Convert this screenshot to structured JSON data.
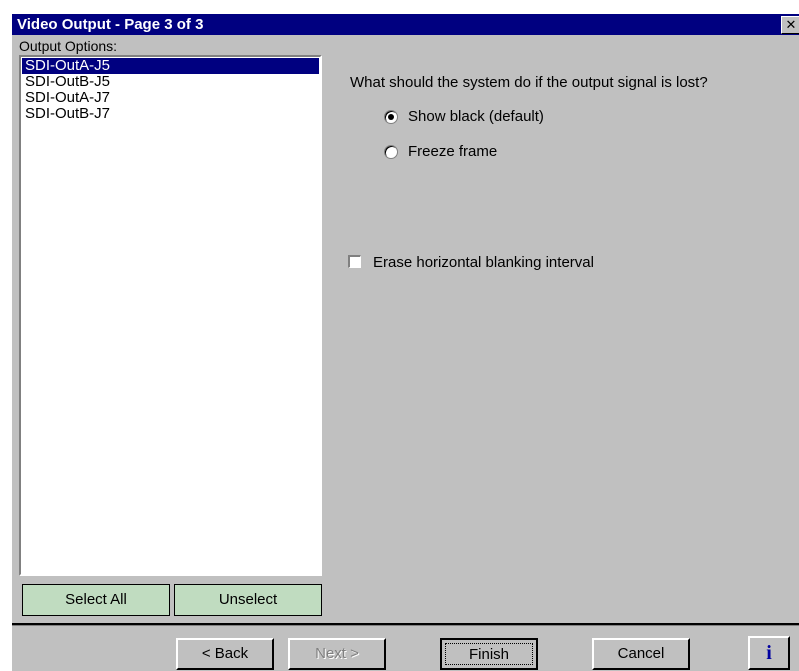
{
  "window": {
    "title": "Video Output - Page 3 of 3",
    "close_glyph": "✕"
  },
  "options": {
    "label": "Output Options:",
    "items": [
      "SDI-OutA-J5",
      "SDI-OutB-J5",
      "SDI-OutA-J7",
      "SDI-OutB-J7"
    ],
    "selected_index": 0,
    "select_all_label": "Select All",
    "unselect_label": "Unselect"
  },
  "signal_lost": {
    "question": "What should the system do if the output signal is lost?",
    "options": [
      {
        "label": "Show black (default)",
        "checked": true
      },
      {
        "label": "Freeze frame",
        "checked": false
      }
    ]
  },
  "blanking": {
    "label": "Erase horizontal blanking interval",
    "checked": false
  },
  "buttons": {
    "back": "< Back",
    "next": "Next >",
    "finish": "Finish",
    "cancel": "Cancel",
    "info": "i"
  },
  "colors": {
    "title_bar": "#000080",
    "selection": "#000080",
    "dialog_bg": "#c0c0c0",
    "list_button_bg": "#c0dcc0",
    "info_icon": "#0000a0"
  }
}
